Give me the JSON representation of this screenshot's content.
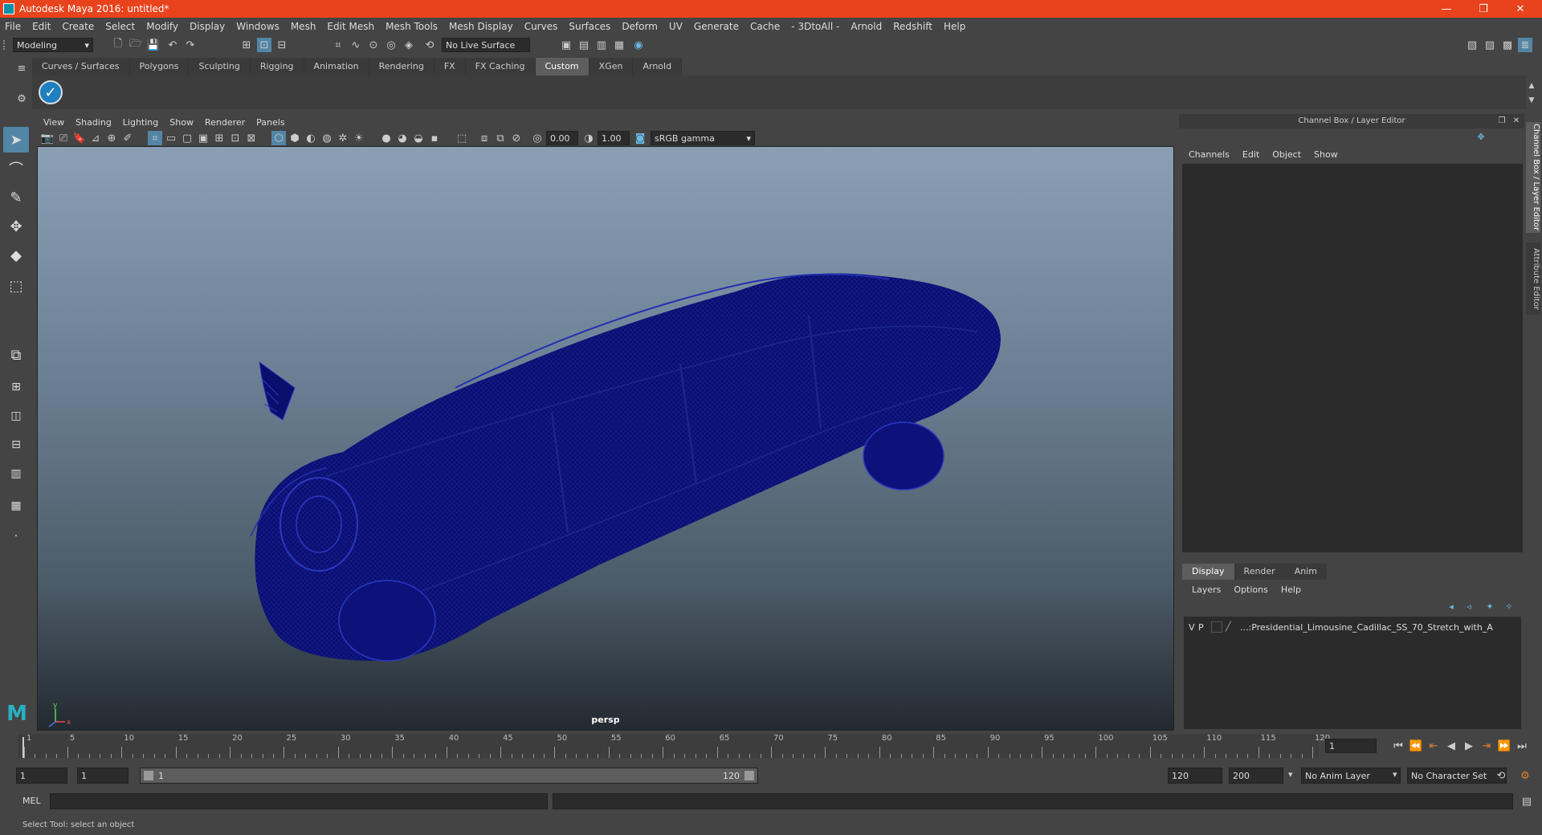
{
  "window": {
    "title": "Autodesk Maya 2016: untitled*",
    "controls": [
      "—",
      "❐",
      "✕"
    ]
  },
  "menubar": [
    "File",
    "Edit",
    "Create",
    "Select",
    "Modify",
    "Display",
    "Windows",
    "Mesh",
    "Edit Mesh",
    "Mesh Tools",
    "Mesh Display",
    "Curves",
    "Surfaces",
    "Deform",
    "UV",
    "Generate",
    "Cache",
    "- 3DtoAll -",
    "Arnold",
    "Redshift",
    "Help"
  ],
  "statusline": {
    "mode": "Modeling",
    "live_surface": "No Live Surface"
  },
  "shelf": {
    "tabs": [
      "Curves / Surfaces",
      "Polygons",
      "Sculpting",
      "Rigging",
      "Animation",
      "Rendering",
      "FX",
      "FX Caching",
      "Custom",
      "XGen",
      "Arnold"
    ],
    "active": "Custom"
  },
  "viewport": {
    "menu": [
      "View",
      "Shading",
      "Lighting",
      "Show",
      "Renderer",
      "Panels"
    ],
    "exposure": "0.00",
    "gamma": "1.00",
    "color_space": "sRGB gamma",
    "camera_label": "persp",
    "wire_color": "#0a0f6e"
  },
  "channelbox": {
    "header": "Channel Box / Layer Editor",
    "menu": [
      "Channels",
      "Edit",
      "Object",
      "Show"
    ],
    "layer_tabs": [
      "Display",
      "Render",
      "Anim"
    ],
    "active_layer_tab": "Display",
    "layer_menu": [
      "Layers",
      "Options",
      "Help"
    ],
    "layer": {
      "v": "V",
      "p": "P",
      "name": "...:Presidential_Limousine_Cadillac_SS_70_Stretch_with_A"
    }
  },
  "sidetabs": [
    "Channel Box / Layer Editor",
    "Attribute Editor"
  ],
  "timeline": {
    "ticks": [
      1,
      5,
      10,
      15,
      20,
      25,
      30,
      35,
      40,
      45,
      50,
      55,
      60,
      65,
      70,
      75,
      80,
      85,
      90,
      95,
      100,
      105,
      110,
      115,
      120
    ],
    "current_frame": "1"
  },
  "range": {
    "start": "1",
    "anim_start": "1",
    "slider_start": "1",
    "slider_end": "120",
    "end": "120",
    "anim_end": "200",
    "anim_layer": "No Anim Layer",
    "character_set": "No Character Set"
  },
  "cmdline": {
    "label": "MEL"
  },
  "helpline": {
    "text": "Select Tool: select an object"
  }
}
